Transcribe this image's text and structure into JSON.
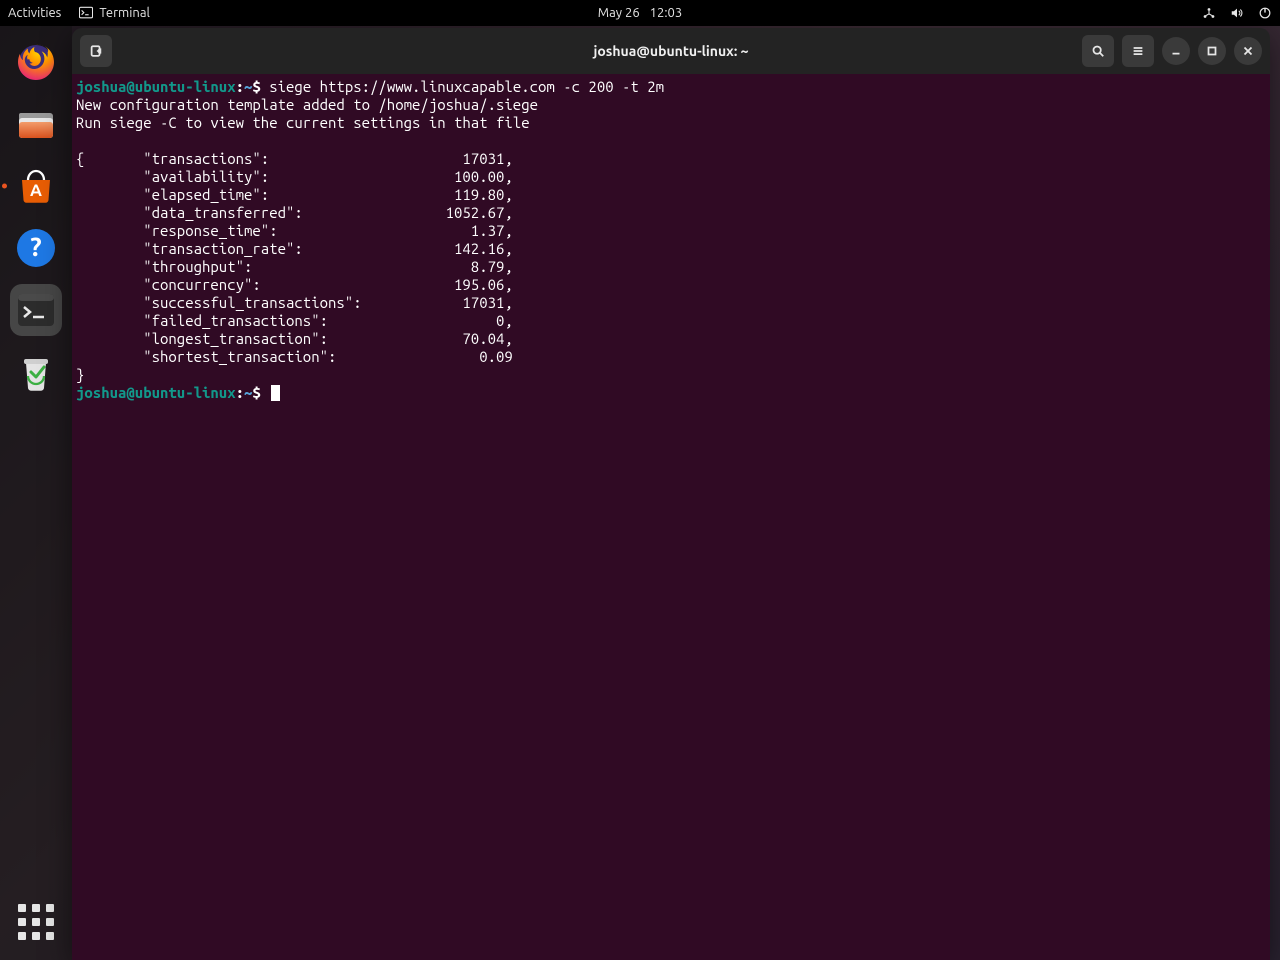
{
  "topbar": {
    "activities": "Activities",
    "app_label": "Terminal",
    "date": "May 26",
    "time": "12:03"
  },
  "dock": {
    "firefox": "Firefox",
    "files": "Files",
    "software": "Ubuntu Software",
    "help": "Help",
    "terminal": "Terminal",
    "trash": "Trash",
    "apps": "Show Applications"
  },
  "window": {
    "title": "joshua@ubuntu-linux: ~"
  },
  "terminal": {
    "prompt_user_host": "joshua@ubuntu-linux",
    "prompt_sep": ":",
    "prompt_path": "~",
    "prompt_symbol": "$",
    "command": "siege https://www.linuxcapable.com -c 200 -t 2m",
    "config_line1": "New configuration template added to /home/joshua/.siege",
    "config_line2": "Run siege -C to view the current settings in that file",
    "blank": "",
    "open_brace": "{",
    "close_brace": "}",
    "metrics": [
      {
        "key": "transactions",
        "value": "17031,"
      },
      {
        "key": "availability",
        "value": "100.00,"
      },
      {
        "key": "elapsed_time",
        "value": "119.80,"
      },
      {
        "key": "data_transferred",
        "value": "1052.67,"
      },
      {
        "key": "response_time",
        "value": "1.37,"
      },
      {
        "key": "transaction_rate",
        "value": "142.16,"
      },
      {
        "key": "throughput",
        "value": "8.79,"
      },
      {
        "key": "concurrency",
        "value": "195.06,"
      },
      {
        "key": "successful_transactions",
        "value": "17031,"
      },
      {
        "key": "failed_transactions",
        "value": "0,"
      },
      {
        "key": "longest_transaction",
        "value": "70.04,"
      },
      {
        "key": "shortest_transaction",
        "value": "0.09"
      }
    ]
  }
}
